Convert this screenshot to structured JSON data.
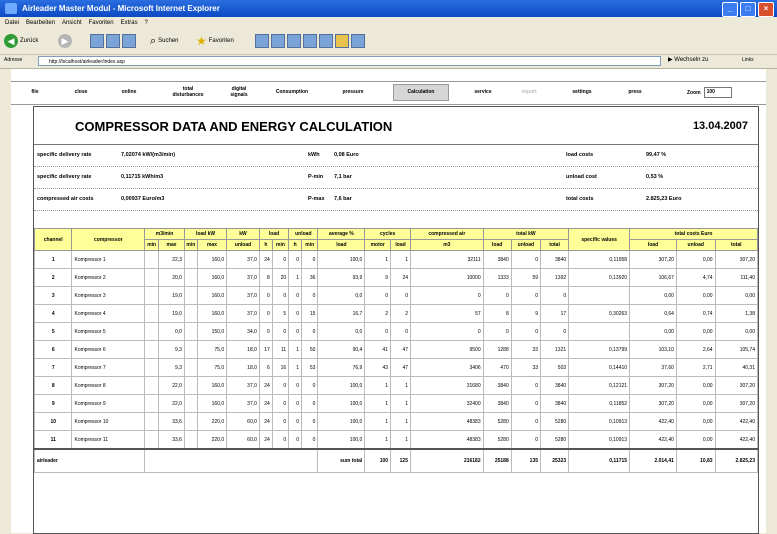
{
  "window": {
    "title": "Airleader Master Modul - Microsoft Internet Explorer"
  },
  "menu": [
    "Datei",
    "Bearbeiten",
    "Ansicht",
    "Favoriten",
    "Extras",
    "?"
  ],
  "toolbar": {
    "back": "Zurück",
    "search": "Suchen",
    "favorites": "Favoriten"
  },
  "address": {
    "label": "Adresse",
    "url": "http://localhost/airleader/index.asp",
    "go": "Wechseln zu",
    "links": "Links"
  },
  "nav": {
    "tabs": [
      "file",
      "close",
      "online",
      "total\ndisturbances",
      "digital\nsignals",
      "Consumption",
      "pressure",
      "Calculation",
      "service",
      "export",
      "settings",
      "press"
    ],
    "zoom_label": "Zoom",
    "zoom_value": "100"
  },
  "report": {
    "title": "COMPRESSOR DATA AND ENERGY CALCULATION",
    "date": "13.04.2007",
    "info": [
      {
        "l1": "specific delivery rate",
        "v1": "7,02074 kW/(m3/min)",
        "l2": "kWh",
        "v2": "0,08 Euro",
        "l3": "load costs",
        "v3": "99,47 %"
      },
      {
        "l1": "specific delivery rate",
        "v1": "0,11715 kWh/m3",
        "l2": "P-min",
        "v2": "7,1 bar",
        "l3": "unload cost",
        "v3": "0,53 %"
      },
      {
        "l1": "compressed air costs",
        "v1": "0,00937 Euro/m3",
        "l2": "P-max",
        "v2": "7,6 bar",
        "l3": "total costs",
        "v3": "2.825,23 Euro"
      }
    ]
  },
  "table": {
    "headers": {
      "channel": "channel",
      "compressor": "compressor",
      "m3min": "m3/min",
      "loadkw": "load kW",
      "kw": "kW",
      "load": "load",
      "unload": "unload",
      "average": "average %",
      "cycles": "cycles",
      "compressed": "compressed air",
      "totalkw": "total kW",
      "specific": "specific values",
      "totalcosts": "total costs Euro"
    },
    "subheaders": {
      "min": "min",
      "max": "max",
      "min2": "min",
      "max2": "max",
      "unload": "unload",
      "h": "h",
      "min3": "min",
      "h2": "h",
      "min4": "min",
      "load": "load",
      "motor": "motor",
      "load2": "load",
      "m3": "m3",
      "load3": "load",
      "unload2": "unload",
      "total": "total",
      "load4": "load",
      "unload3": "unload",
      "total2": "total"
    },
    "rows": [
      [
        "1",
        "Kompressor 1",
        "",
        "22,3",
        "",
        "160,0",
        "37,0",
        "24",
        "0",
        "0",
        "0",
        "100,0",
        "1",
        "1",
        "32111",
        "3840",
        "0",
        "3840",
        "0,11958",
        "307,20",
        "0,00",
        "307,20"
      ],
      [
        "2",
        "Kompressor 2",
        "",
        "20,0",
        "",
        "160,0",
        "37,0",
        "8",
        "20",
        "1",
        "36",
        "93,9",
        "9",
        "24",
        "10000",
        "1333",
        "59",
        "1392",
        "0,13920",
        "106,67",
        "4,74",
        "111,40"
      ],
      [
        "3",
        "Kompressor 3",
        "",
        "19,0",
        "",
        "160,0",
        "37,0",
        "0",
        "0",
        "0",
        "0",
        "0,0",
        "0",
        "0",
        "0",
        "0",
        "0",
        "0",
        "",
        "0,00",
        "0,00",
        "0,00"
      ],
      [
        "4",
        "Kompressor 4",
        "",
        "19,0",
        "",
        "160,0",
        "37,0",
        "0",
        "5",
        "0",
        "15",
        "16,7",
        "2",
        "2",
        "57",
        "8",
        "9",
        "17",
        "0,30263",
        "0,64",
        "0,74",
        "1,38"
      ],
      [
        "5",
        "Kompressor 5",
        "",
        "0,0",
        "",
        "150,0",
        "34,0",
        "0",
        "0",
        "0",
        "0",
        "0,0",
        "0",
        "0",
        "0",
        "0",
        "0",
        "0",
        "",
        "0,00",
        "0,00",
        "0,00"
      ],
      [
        "6",
        "Kompressor 6",
        "",
        "9,3",
        "",
        "75,0",
        "18,0",
        "17",
        "11",
        "1",
        "50",
        "90,4",
        "41",
        "47",
        "9500",
        "1288",
        "33",
        "1321",
        "0,13799",
        "103,10",
        "2,64",
        "105,74"
      ],
      [
        "7",
        "Kompressor 7",
        "",
        "9,3",
        "",
        "75,0",
        "18,0",
        "6",
        "16",
        "1",
        "53",
        "76,9",
        "43",
        "47",
        "3406",
        "470",
        "33",
        "503",
        "0,14410",
        "37,60",
        "2,71",
        "40,31"
      ],
      [
        "8",
        "Kompressor 8",
        "",
        "22,0",
        "",
        "160,0",
        "37,0",
        "24",
        "0",
        "0",
        "0",
        "100,0",
        "1",
        "1",
        "31680",
        "3840",
        "0",
        "3840",
        "0,12121",
        "307,20",
        "0,00",
        "307,20"
      ],
      [
        "9",
        "Kompressor 9",
        "",
        "22,0",
        "",
        "160,0",
        "37,0",
        "24",
        "0",
        "0",
        "0",
        "100,0",
        "1",
        "1",
        "32400",
        "3840",
        "0",
        "3840",
        "0,11852",
        "307,20",
        "0,00",
        "307,20"
      ],
      [
        "10",
        "Kompressor 10",
        "",
        "33,6",
        "",
        "220,0",
        "60,0",
        "24",
        "0",
        "0",
        "0",
        "100,0",
        "1",
        "1",
        "48383",
        "5280",
        "0",
        "5280",
        "0,10913",
        "422,40",
        "0,00",
        "422,40"
      ],
      [
        "11",
        "Kompressor 11",
        "",
        "33,6",
        "",
        "220,0",
        "60,0",
        "24",
        "0",
        "0",
        "0",
        "100,0",
        "1",
        "1",
        "48383",
        "5280",
        "0",
        "5280",
        "0,10913",
        "422,40",
        "0,00",
        "422,40"
      ]
    ],
    "summary": {
      "label": "airleader",
      "sum_label": "sum total",
      "cycles_motor": "100",
      "cycles_load": "125",
      "compressed": "216182",
      "load": "25188",
      "unload": "135",
      "total": "25323",
      "specific": "0,11715",
      "cost_load": "2.014,41",
      "cost_unload": "10,83",
      "cost_total": "2.825,23"
    }
  }
}
